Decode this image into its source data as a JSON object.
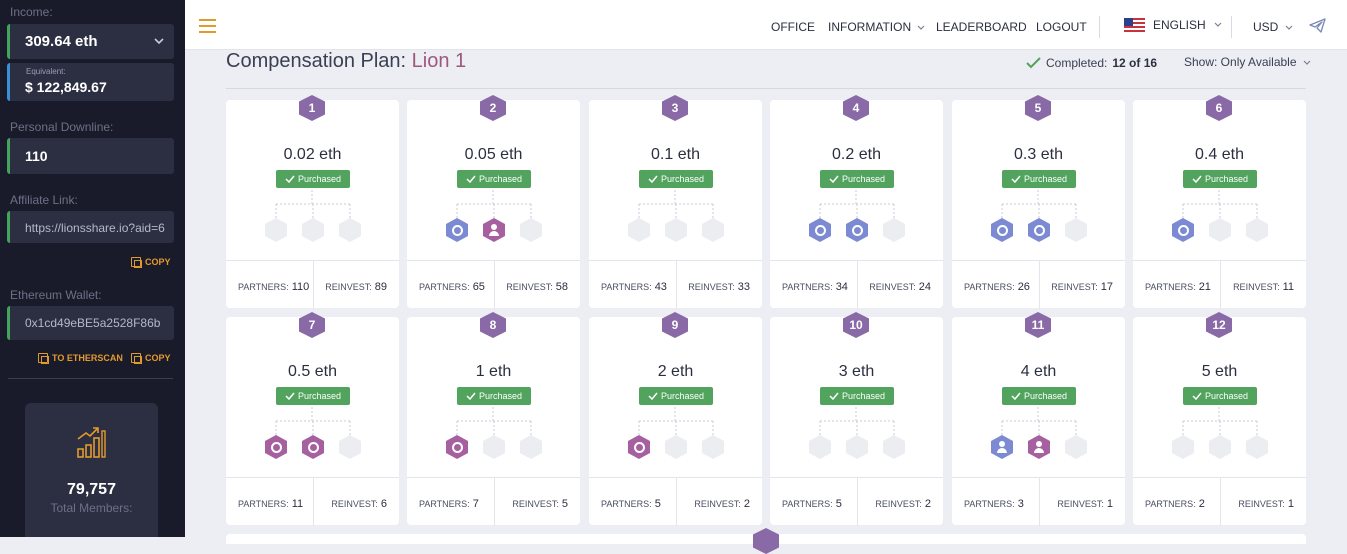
{
  "sidebar": {
    "income_label": "Income:",
    "income_value": "309.64 eth",
    "equivalent_label": "Equivalent:",
    "equivalent_value": "$ 122,849.67",
    "downline_label": "Personal Downline:",
    "downline_value": "110",
    "affiliate_label": "Affiliate Link:",
    "affiliate_value": "https://lionsshare.io?aid=6",
    "copy_label": "COPY",
    "wallet_label": "Ethereum Wallet:",
    "wallet_value": "0x1cd49eBE5a2528F86b",
    "etherscan_label": "TO ETHERSCAN",
    "wallet_copy_label": "COPY",
    "members_value": "79,757",
    "members_label": "Total Members:"
  },
  "topbar": {
    "office": "OFFICE",
    "information": "INFORMATION",
    "leaderboard": "LEADERBOARD",
    "logout": "LOGOUT",
    "language": "ENGLISH",
    "currency": "USD"
  },
  "main": {
    "title_prefix": "Compensation Plan:",
    "title_level": "Lion 1",
    "completed_label": "Completed:",
    "completed_value": "12 of 16",
    "show_filter": "Show: Only Available",
    "partners_label": "PARTNERS:",
    "reinvest_label": "REINVEST:",
    "purchased_label": "Purchased"
  },
  "colors": {
    "accent": "#e39a2d",
    "level": "#a0577f",
    "purchased": "#52a35e",
    "blue_slot": "#7c8ad3",
    "purple_slot": "#a660a0"
  },
  "cards": [
    {
      "num": "1",
      "price": "0.02 eth",
      "status": "Purchased",
      "partners": "110",
      "reinvest": "89",
      "slots": [
        "empty",
        "empty",
        "empty"
      ]
    },
    {
      "num": "2",
      "price": "0.05 eth",
      "status": "Purchased",
      "partners": "65",
      "reinvest": "58",
      "slots": [
        "blue-ring",
        "purple-user",
        "empty"
      ]
    },
    {
      "num": "3",
      "price": "0.1 eth",
      "status": "Purchased",
      "partners": "43",
      "reinvest": "33",
      "slots": [
        "empty",
        "empty",
        "empty"
      ]
    },
    {
      "num": "4",
      "price": "0.2 eth",
      "status": "Purchased",
      "partners": "34",
      "reinvest": "24",
      "slots": [
        "blue-ring",
        "blue-ring",
        "empty"
      ]
    },
    {
      "num": "5",
      "price": "0.3 eth",
      "status": "Purchased",
      "partners": "26",
      "reinvest": "17",
      "slots": [
        "blue-ring",
        "blue-ring",
        "empty"
      ]
    },
    {
      "num": "6",
      "price": "0.4 eth",
      "status": "Purchased",
      "partners": "21",
      "reinvest": "11",
      "slots": [
        "blue-ring",
        "empty",
        "empty"
      ]
    },
    {
      "num": "7",
      "price": "0.5 eth",
      "status": "Purchased",
      "partners": "11",
      "reinvest": "6",
      "slots": [
        "purple-ring",
        "purple-ring",
        "empty"
      ]
    },
    {
      "num": "8",
      "price": "1 eth",
      "status": "Purchased",
      "partners": "7",
      "reinvest": "5",
      "slots": [
        "purple-ring",
        "empty",
        "empty"
      ]
    },
    {
      "num": "9",
      "price": "2 eth",
      "status": "Purchased",
      "partners": "5",
      "reinvest": "2",
      "slots": [
        "purple-ring",
        "empty",
        "empty"
      ]
    },
    {
      "num": "10",
      "price": "3 eth",
      "status": "Purchased",
      "partners": "5",
      "reinvest": "2",
      "slots": [
        "empty",
        "empty",
        "empty"
      ]
    },
    {
      "num": "11",
      "price": "4 eth",
      "status": "Purchased",
      "partners": "3",
      "reinvest": "1",
      "slots": [
        "blue-user",
        "purple-user",
        "empty"
      ]
    },
    {
      "num": "12",
      "price": "5 eth",
      "status": "Purchased",
      "partners": "2",
      "reinvest": "1",
      "slots": [
        "empty",
        "empty",
        "empty"
      ]
    }
  ]
}
